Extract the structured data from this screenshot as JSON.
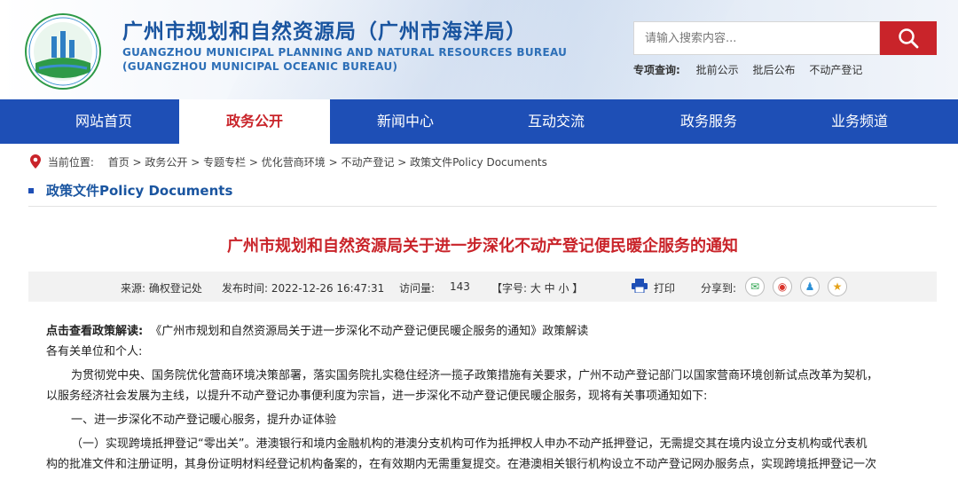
{
  "header": {
    "title_cn": "广州市规划和自然资源局（广州市海洋局）",
    "title_en_1": "GUANGZHOU MUNICIPAL PLANNING AND NATURAL RESOURCES BUREAU",
    "title_en_2": "(GUANGZHOU MUNICIPAL OCEANIC BUREAU)",
    "logo_text": "广州市规划和自然资源局"
  },
  "search": {
    "placeholder": "请输入搜索内容..."
  },
  "quick": {
    "label": "专项查询:",
    "links": [
      "批前公示",
      "批后公布",
      "不动产登记"
    ]
  },
  "nav": {
    "items": [
      "网站首页",
      "政务公开",
      "新闻中心",
      "互动交流",
      "政务服务",
      "业务频道"
    ],
    "active_index": 1
  },
  "breadcrumb": {
    "label": "当前位置:",
    "path": "首页 > 政务公开 > 专题专栏 > 优化营商环境 > 不动产登记 > 政策文件Policy Documents"
  },
  "section_title": "政策文件Policy Documents",
  "article": {
    "title": "广州市规划和自然资源局关于进一步深化不动产登记便民暖企服务的通知",
    "source": "来源: 确权登记处",
    "time": "发布时间: 2022-12-26 16:47:31",
    "visits_label": "访问量:",
    "visits": "143",
    "font_size": "【字号: 大 中 小 】",
    "print": "打印",
    "share_label": "分享到:"
  },
  "body": {
    "p1_bold": "点击查看政策解读:",
    "p1_text": "《广州市规划和自然资源局关于进一步深化不动产登记便民暖企服务的通知》政策解读",
    "p2": "各有关单位和个人:",
    "p3": "为贯彻党中央、国务院优化营商环境决策部署，落实国务院扎实稳住经济一揽子政策措施有关要求，广州不动产登记部门以国家营商环境创新试点改革为契机，",
    "p4": "以服务经济社会发展为主线，以提升不动产登记办事便利度为宗旨，进一步深化不动产登记便民暖企服务，现将有关事项通知如下:",
    "p5": "一、进一步深化不动产登记暖心服务，提升办证体验",
    "p6": "（一）实现跨境抵押登记“零出关”。港澳银行和境内金融机构的港澳分支机构可作为抵押权人申办不动产抵押登记，无需提交其在境内设立分支机构或代表机",
    "p7": "构的批准文件和注册证明，其身份证明材料经登记机构备案的，在有效期内无需重复提交。在港澳相关银行机构设立不动产登记网办服务点，实现跨境抵押登记一次"
  },
  "colors": {
    "nav_bg": "#1e4fb6",
    "accent_red": "#c9242a",
    "brand_blue": "#1a55a0"
  }
}
